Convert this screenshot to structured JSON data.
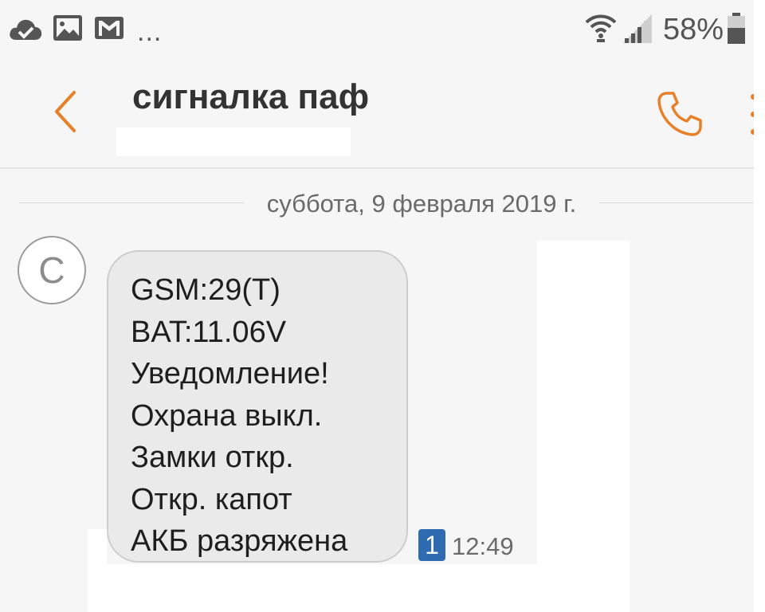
{
  "status_bar": {
    "left_icons": [
      "cloud-check-icon",
      "gallery-icon",
      "gmail-icon"
    ],
    "overflow": "...",
    "battery_percent": "58%",
    "right_icons": [
      "wifi-icon",
      "signal-icon",
      "battery-icon"
    ]
  },
  "header": {
    "title": "сигналка паф",
    "subtitle": "",
    "back_icon": "chevron-left-icon",
    "call_icon": "phone-icon",
    "more_icon": "more-vertical-icon"
  },
  "conversation": {
    "date_separator": "суббота, 9 февраля 2019 г.",
    "messages": [
      {
        "avatar_letter": "С",
        "lines": [
          "GSM:29(T)",
          "BAT:11.06V",
          "Уведомление!",
          "Охрана выкл.",
          "Замки откр.",
          "Откр. капот",
          "АКБ разряжена"
        ],
        "sim": "1",
        "time": "12:49"
      }
    ]
  },
  "colors": {
    "accent": "#e8802a",
    "background": "#f6f6f6",
    "bubble": "#eaeaea",
    "sim_badge": "#2e6bb0"
  }
}
